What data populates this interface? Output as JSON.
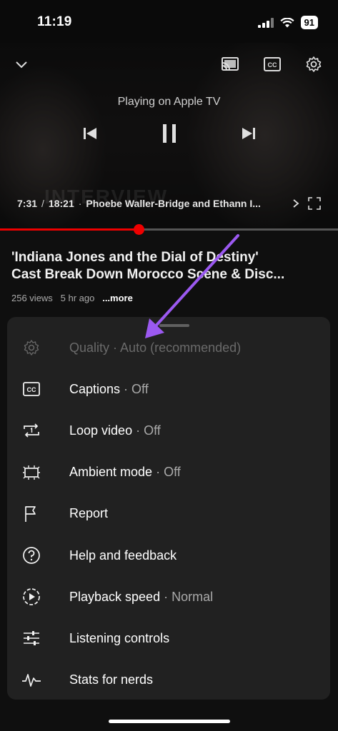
{
  "status_bar": {
    "time": "11:19",
    "battery": "91"
  },
  "player": {
    "playing_on": "Playing on Apple TV",
    "current_time": "7:31",
    "duration": "18:21",
    "time_sep": "/",
    "chapter_dot": "·",
    "chapter": "Phoebe Waller-Bridge and Ethann I...",
    "watermark": "INTERVIEW",
    "progress_fraction": 0.41,
    "icons": {
      "minimize": "chevron-down-icon",
      "cast": "cast-icon",
      "captions": "cc-icon",
      "settings": "gear-icon",
      "previous": "skip-previous-icon",
      "pause": "pause-icon",
      "next": "skip-next-icon",
      "chapter_arrow": "chevron-right-icon",
      "fullscreen": "fullscreen-icon"
    }
  },
  "video": {
    "title_line1": "'Indiana Jones and the Dial of Destiny'",
    "title_line2": "Cast Break Down Morocco Scene & Disc...",
    "views": "256 views",
    "age": "5 hr ago",
    "more": "...more"
  },
  "menu": {
    "items": [
      {
        "label": "Quality",
        "sep": " · ",
        "value": "Auto (recommended)",
        "icon": "gear-icon",
        "disabled": true
      },
      {
        "label": "Captions",
        "sep": " · ",
        "value": "Off",
        "icon": "cc-icon"
      },
      {
        "label": "Loop video",
        "sep": " · ",
        "value": "Off",
        "icon": "loop-icon"
      },
      {
        "label": "Ambient mode",
        "sep": " · ",
        "value": "Off",
        "icon": "ambient-mode-icon"
      },
      {
        "label": "Report",
        "sep": "",
        "value": "",
        "icon": "flag-icon"
      },
      {
        "label": "Help and feedback",
        "sep": "",
        "value": "",
        "icon": "help-icon"
      },
      {
        "label": "Playback speed",
        "sep": " · ",
        "value": "Normal",
        "icon": "playback-speed-icon"
      },
      {
        "label": "Listening controls",
        "sep": "",
        "value": "",
        "icon": "sliders-icon"
      },
      {
        "label": "Stats for nerds",
        "sep": "",
        "value": "",
        "icon": "pulse-icon"
      }
    ]
  },
  "colors": {
    "accent": "#ff0000",
    "annotation_arrow": "#9b59f0",
    "sheet_bg": "#212121"
  }
}
